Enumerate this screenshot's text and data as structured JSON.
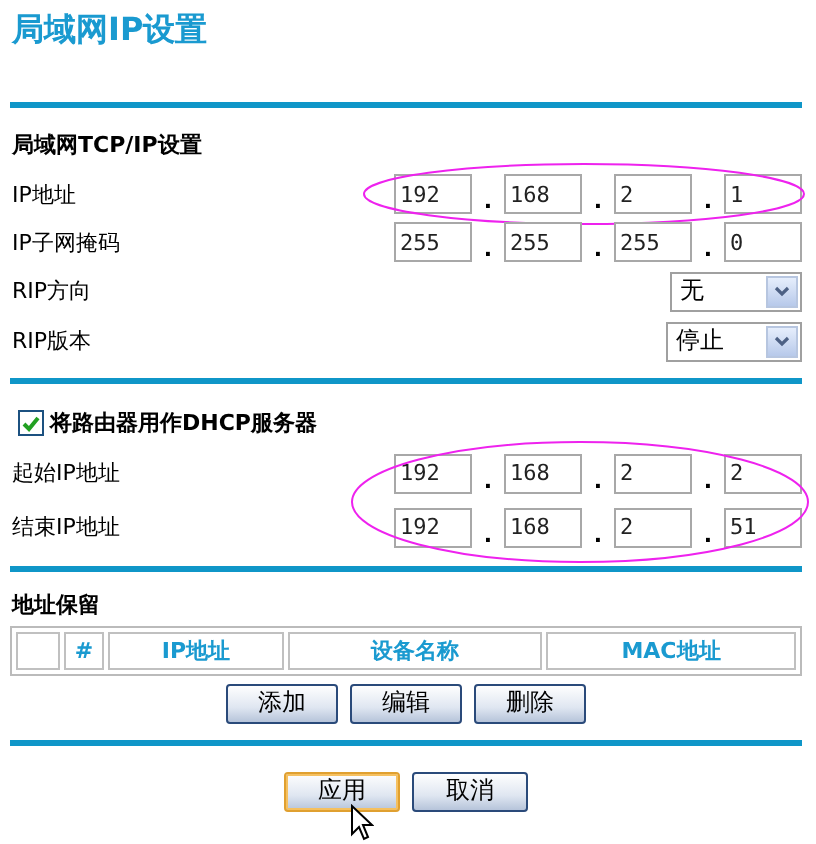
{
  "title": "局域网IP设置",
  "octet_separator": ".",
  "lan": {
    "heading": "局域网TCP/IP设置",
    "ip_rows": [
      {
        "label": "IP地址",
        "octets": [
          "192",
          "168",
          "2",
          "1"
        ],
        "circled": true
      },
      {
        "label": "IP子网掩码",
        "octets": [
          "255",
          "255",
          "255",
          "0"
        ],
        "circled": false
      }
    ],
    "select_rows": [
      {
        "label": "RIP方向",
        "value": "无"
      },
      {
        "label": "RIP版本",
        "value": "停止"
      }
    ]
  },
  "dhcp": {
    "label": "将路由器用作DHCP服务器",
    "checked": true,
    "circled": true,
    "ip_rows": [
      {
        "label": "起始IP地址",
        "octets": [
          "192",
          "168",
          "2",
          "2"
        ]
      },
      {
        "label": "结束IP地址",
        "octets": [
          "192",
          "168",
          "2",
          "51"
        ]
      }
    ]
  },
  "reservation": {
    "heading": "地址保留",
    "columns": [
      "",
      "#",
      "IP地址",
      "设备名称",
      "MAC地址"
    ],
    "buttons": [
      "添加",
      "编辑",
      "删除"
    ]
  },
  "actions": [
    {
      "label": "应用",
      "hovered": true
    },
    {
      "label": "取消",
      "hovered": false
    }
  ]
}
